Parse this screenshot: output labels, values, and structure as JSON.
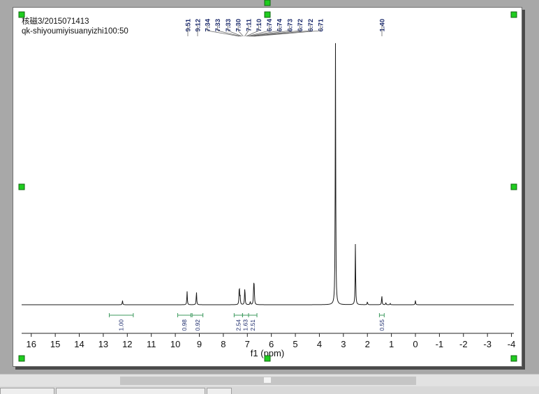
{
  "document": {
    "title_line1": "核磁3/2015071413",
    "title_line2": "qk-shiyoumiyisuanyizhi100:50"
  },
  "chart_data": {
    "type": "line",
    "title": "核磁3/2015071413",
    "subtitle": "qk-shiyoumiyisuanyizhi100:50",
    "xlabel": "f1 (ppm)",
    "ylabel": "",
    "xlim": [
      16.4,
      -4.1
    ],
    "x_reversed": true,
    "x_ticks": [
      16,
      15,
      14,
      13,
      12,
      11,
      10,
      9,
      8,
      7,
      6,
      5,
      4,
      3,
      2,
      1,
      0,
      -1,
      -2,
      -3,
      -4
    ],
    "grid": false,
    "series": [
      {
        "peaks": [
          {
            "ppm": 12.2,
            "intensity": 0.016
          },
          {
            "ppm": 9.51,
            "intensity": 0.052
          },
          {
            "ppm": 9.12,
            "intensity": 0.052
          },
          {
            "ppm": 7.34,
            "intensity": 0.038
          },
          {
            "ppm": 7.33,
            "intensity": 0.038
          },
          {
            "ppm": 7.3,
            "intensity": 0.03
          },
          {
            "ppm": 7.11,
            "intensity": 0.036
          },
          {
            "ppm": 7.1,
            "intensity": 0.036
          },
          {
            "ppm": 6.88,
            "intensity": 0.012
          },
          {
            "ppm": 6.74,
            "intensity": 0.034
          },
          {
            "ppm": 6.73,
            "intensity": 0.036
          },
          {
            "ppm": 6.72,
            "intensity": 0.034
          },
          {
            "ppm": 6.71,
            "intensity": 0.03
          },
          {
            "ppm": 3.33,
            "intensity": 1.0
          },
          {
            "ppm": 2.5,
            "intensity": 0.232
          },
          {
            "ppm": 2.0,
            "intensity": 0.012
          },
          {
            "ppm": 1.4,
            "intensity": 0.036
          },
          {
            "ppm": 1.23,
            "intensity": 0.008
          },
          {
            "ppm": 1.05,
            "intensity": 0.005
          },
          {
            "ppm": 0.0,
            "intensity": 0.016
          }
        ]
      }
    ],
    "peak_labels": [
      "9.51",
      "9.12",
      "7.34",
      "7.33",
      "7.33",
      "7.30",
      "7.11",
      "7.10",
      "6.74",
      "6.74",
      "6.73",
      "6.72",
      "6.72",
      "6.71",
      "1.40"
    ],
    "peak_label_groups": [
      {
        "labels": [
          "9.51"
        ],
        "ppm_range": [
          9.51,
          9.51
        ]
      },
      {
        "labels": [
          "9.12"
        ],
        "ppm_range": [
          9.12,
          9.12
        ]
      },
      {
        "labels": [
          "7.34",
          "7.33",
          "7.33",
          "7.30",
          "7.11",
          "7.10",
          "6.74",
          "6.74",
          "6.73",
          "6.72",
          "6.72",
          "6.71"
        ],
        "ppm_range": [
          7.34,
          6.71
        ]
      },
      {
        "labels": [
          "1.40"
        ],
        "ppm_range": [
          1.4,
          1.4
        ]
      }
    ],
    "integrals": [
      {
        "value": "1.00",
        "from": 12.75,
        "to": 11.75
      },
      {
        "value": "0.98",
        "from": 9.9,
        "to": 9.35
      },
      {
        "value": "0.92",
        "from": 9.3,
        "to": 8.85
      },
      {
        "value": "2.54",
        "from": 7.55,
        "to": 7.2
      },
      {
        "value": "1.63",
        "from": 7.2,
        "to": 6.95
      },
      {
        "value": "2.51",
        "from": 6.95,
        "to": 6.6
      },
      {
        "value": "0.55",
        "from": 1.5,
        "to": 1.3
      }
    ],
    "colors": {
      "spectrum": "#1a1a1a",
      "peak_labels": "#1b2a6b",
      "integral_bracket": "#3d9a5e",
      "integral_text": "#1b2a6b",
      "handles": "#1fcc1f"
    }
  }
}
